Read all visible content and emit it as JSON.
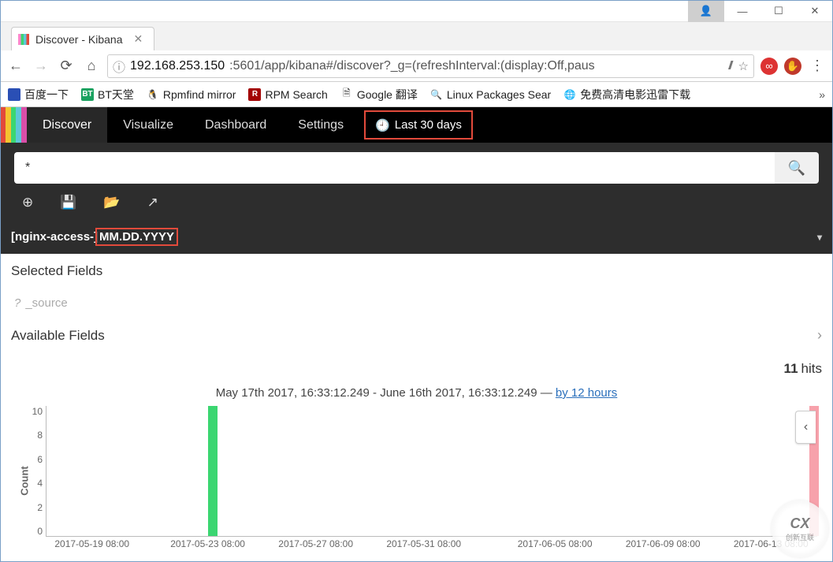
{
  "window": {
    "tab_title": "Discover - Kibana",
    "url_host": "192.168.253.150",
    "url_port_path": ":5601/app/kibana#/discover?_g=(refreshInterval:(display:Off,paus"
  },
  "bookmarks": [
    {
      "label": "百度一下",
      "color": "#2a4fb5"
    },
    {
      "label": "BT天堂",
      "badge": "BT",
      "color": "#1aa260"
    },
    {
      "label": "Rpmfind mirror",
      "icon": "🐧"
    },
    {
      "label": "RPM Search",
      "badge": "R",
      "color": "#a30000"
    },
    {
      "label": "Google 翻译",
      "icon": "🗎"
    },
    {
      "label": "Linux Packages Sear",
      "icon": "🔍"
    },
    {
      "label": "免费高清电影迅雷下载",
      "icon": "🌐"
    }
  ],
  "kibana": {
    "brand_colors": [
      "#e24a3b",
      "#f4c430",
      "#3bd671",
      "#5dc7d8",
      "#d94ea8"
    ],
    "nav": [
      "Discover",
      "Visualize",
      "Dashboard",
      "Settings"
    ],
    "active_nav": "Discover",
    "time_label": "Last 30 days",
    "search_value": "*",
    "index_pattern_prefix": "[nginx-access-]",
    "index_pattern_suffix": "MM.DD.YYYY",
    "selected_fields_head": "Selected Fields",
    "selected_field_item": "_source",
    "available_fields_head": "Available Fields",
    "hits_count": "11",
    "hits_label": "hits",
    "timerange_text": "May 17th 2017, 16:33:12.249 - June 16th 2017, 16:33:12.249 — ",
    "interval_link": "by 12 hours"
  },
  "chart_data": {
    "type": "bar",
    "ylabel": "Count",
    "ylim": [
      0,
      10
    ],
    "y_ticks": [
      "10",
      "8",
      "6",
      "4",
      "2",
      "0"
    ],
    "x_ticks": [
      {
        "label": "2017-05-19 08:00",
        "pos": 6
      },
      {
        "label": "2017-05-23 08:00",
        "pos": 21
      },
      {
        "label": "2017-05-27 08:00",
        "pos": 35
      },
      {
        "label": "2017-05-31 08:00",
        "pos": 49
      },
      {
        "label": "2017-06-05 08:00",
        "pos": 66
      },
      {
        "label": "2017-06-09 08:00",
        "pos": 80
      },
      {
        "label": "2017-06-13 08:00",
        "pos": 94
      }
    ],
    "bars": [
      {
        "x_pct": 21,
        "value": 10,
        "color": "#3bd671"
      },
      {
        "x_pct": 99,
        "value": 10,
        "color": "#f7a1ab"
      }
    ]
  },
  "watermark": {
    "big": "CX",
    "small": "创新互联"
  }
}
